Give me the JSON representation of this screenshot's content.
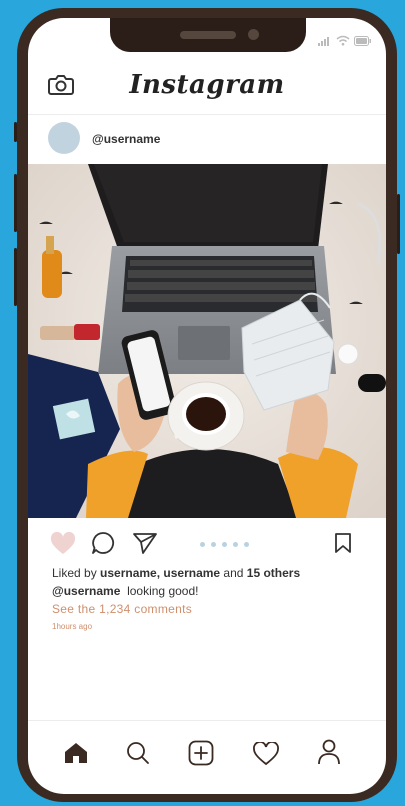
{
  "header": {
    "title": "Instagram"
  },
  "post": {
    "username": "@username",
    "liked_prefix": "Liked by ",
    "liked_users": "username, username",
    "liked_and": " and ",
    "liked_others": "15 others",
    "caption_user": "@username",
    "caption_text": "looking good!",
    "comments_link": "See the 1,234 comments",
    "time_ago": "1hours ago",
    "liked": true,
    "carousel_dots": 5
  },
  "colors": {
    "background": "#29a7dc",
    "phone_frame": "#3a2a22",
    "like_fill": "#efd3d1",
    "accent_text": "#cf8f6d",
    "icon_dark": "#3a2a22"
  },
  "icons": {
    "camera": "camera-icon",
    "like": "heart-icon",
    "comment": "comment-icon",
    "share": "send-icon",
    "save": "bookmark-icon",
    "home": "home-icon",
    "search": "search-icon",
    "add": "add-post-icon",
    "activity": "heart-outline-icon",
    "profile": "profile-icon"
  }
}
